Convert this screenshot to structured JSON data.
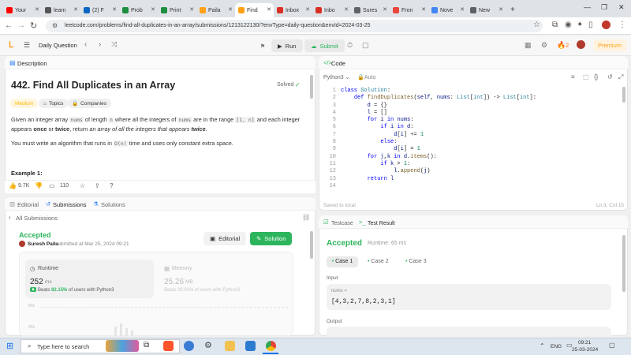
{
  "browser": {
    "tabs": [
      {
        "label": "Your",
        "color": "#ff0000"
      },
      {
        "label": "learn",
        "color": "#555555"
      },
      {
        "label": "(2) F",
        "color": "#0a66c2"
      },
      {
        "label": "Prob",
        "color": "#1e8e3e"
      },
      {
        "label": "Print",
        "color": "#1e8e3e"
      },
      {
        "label": "Paila",
        "color": "#ffa116"
      },
      {
        "label": "Find",
        "color": "#ffa116"
      },
      {
        "label": "Inbox",
        "color": "#d93025"
      },
      {
        "label": "Inbo",
        "color": "#d93025"
      },
      {
        "label": "Sures",
        "color": "#5f6368"
      },
      {
        "label": "Fron",
        "color": "#e8453c"
      },
      {
        "label": "Nove",
        "color": "#4285f4"
      },
      {
        "label": "New",
        "color": "#5f6368"
      }
    ],
    "url": "leetcode.com/problems/find-all-duplicates-in-an-array/submissions/1213122130/?envType=daily-question&envId=2024-03-25"
  },
  "topbar": {
    "daily": "Daily Question",
    "run": "Run",
    "submit": "Submit",
    "streak": "2",
    "premium": "Premium"
  },
  "description": {
    "tab": "Description",
    "title": "442. Find All Duplicates in an Array",
    "solved": "Solved",
    "difficulty": "Medium",
    "topics": "Topics",
    "companies": "Companies",
    "p1_a": "Given an integer array ",
    "p1_nums": "nums",
    "p1_b": " of length ",
    "p1_n": "n",
    "p1_c": " where all the integers of ",
    "p1_nums2": "nums",
    "p1_d": " are in the range ",
    "p1_range": "[1, n]",
    "p1_e": " and each integer appears ",
    "p1_once": "once",
    "p1_f": " or ",
    "p1_twice": "twice",
    "p1_g": ", return ",
    "p1_h": "an array of all the integers that appears ",
    "p1_twice2": "twice",
    "p1_end": ".",
    "p2_a": "You must write an algorithm that runs in ",
    "p2_on": "O(n)",
    "p2_b": " time and uses only constant extra space.",
    "example": "Example 1:",
    "likes": "9.7K",
    "comments": "110"
  },
  "submission": {
    "tabs": {
      "editorial": "Editorial",
      "submissions": "Submissions",
      "solutions": "Solutions"
    },
    "back": "All Submissions",
    "status": "Accepted",
    "author": "Suresh Paila",
    "submitted": "submitted at Mar 25, 2024 09:21",
    "editorial_btn": "Editorial",
    "solution_btn": "Solution",
    "runtime_label": "Runtime",
    "runtime_value": "252",
    "runtime_unit": "ms",
    "beats_label": "Beats",
    "runtime_beats": "82.15%",
    "beats_suffix": "of users with Python3",
    "memory_label": "Memory",
    "memory_value": "25.26",
    "memory_unit": "MB",
    "memory_beats": "Beats 39.93% of users with Python3",
    "axis_1": "6%",
    "axis_2": "0%"
  },
  "code": {
    "tab": "Code",
    "language": "Python3",
    "mode": "Auto",
    "saved": "Saved to local",
    "cursor": "Ln 3, Col 15"
  },
  "testresult": {
    "testcase_tab": "Testcase",
    "result_tab": "Test Result",
    "status": "Accepted",
    "runtime": "Runtime: 65 ms",
    "cases": [
      "Case 1",
      "Case 2",
      "Case 3"
    ],
    "input_label": "Input",
    "var_name": "nums =",
    "input_value": "[4,3,2,7,8,2,3,1]",
    "output_label": "Output"
  },
  "taskbar": {
    "search": "Type here to search",
    "lang": "ENG",
    "time": "09:21",
    "date": "25-03-2024"
  }
}
